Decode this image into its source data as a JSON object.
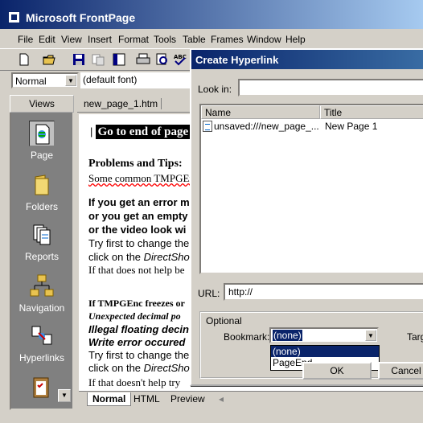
{
  "app": {
    "title": "Microsoft FrontPage",
    "menu": [
      "File",
      "Edit",
      "View",
      "Insert",
      "Format",
      "Tools",
      "Table",
      "Frames",
      "Window",
      "Help"
    ],
    "style_combo": "Normal",
    "font_combo": "(default font)"
  },
  "views": {
    "header": "Views",
    "items": [
      "Page",
      "Folders",
      "Reports",
      "Navigation",
      "Hyperlinks"
    ]
  },
  "editor": {
    "filename": "new_page_1.htm",
    "heading": "Go to end of page",
    "section_title": "Problems and Tips:",
    "intro": "Some common TMPGEnc",
    "q1_line1": "If you get an error m",
    "q1_line2": "or you get an empty",
    "q1_line3": "or the video look wi",
    "try1_line1": "Try first to change the",
    "try1_line2_pre": "click on the ",
    "try1_line2_italic": "DirectSho",
    "if_not": "If that does not help be",
    "freeze": "If TMPGEnc freezes or",
    "unexpected": "Unexpected decimal po",
    "illegal": "Illegal floating decin",
    "write_err": "Write error occured",
    "try2_line1": "Try first to change the",
    "try2_line2_pre": "click on the ",
    "try2_line2_italic": "DirectSho",
    "if_doesnt": "If that doesn't help try"
  },
  "bottom_tabs": [
    "Normal",
    "HTML",
    "Preview"
  ],
  "dialog": {
    "title": "Create Hyperlink",
    "look_in_label": "Look in:",
    "col_name": "Name",
    "col_title": "Title",
    "row_name": "unsaved:///new_page_...",
    "row_title": "New Page 1",
    "url_label": "URL:",
    "url_value": "http://",
    "optional_label": "Optional",
    "bookmark_label": "Bookmark:",
    "bookmark_value": "(none)",
    "bookmark_options": [
      "(none)",
      "PageEnd"
    ],
    "target_label": "Targ",
    "ok_label": "OK",
    "cancel_label": "Cancel"
  }
}
